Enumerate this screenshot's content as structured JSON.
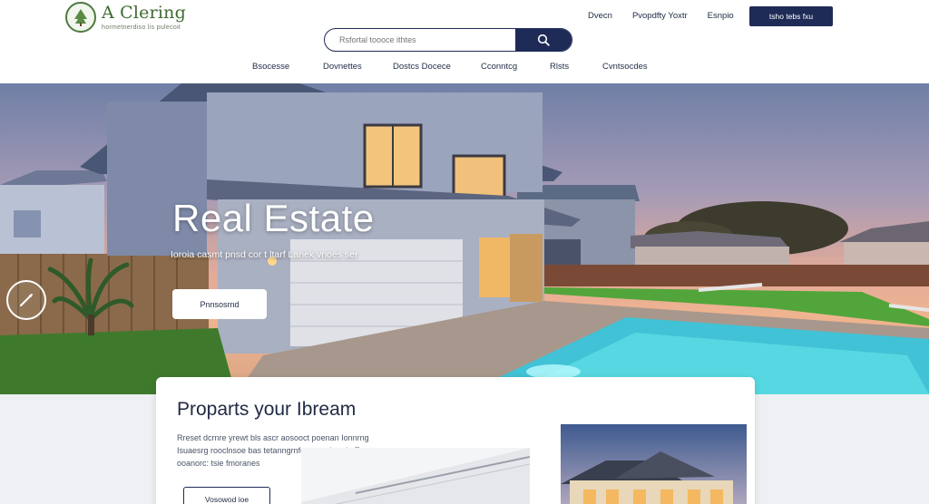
{
  "header": {
    "logo_name": "A Clering",
    "logo_tagline": "hormetnerdiso lis pulecoit",
    "top_links": [
      "Dvecn",
      "Pvopdfty Yoxtr",
      "Esnpio"
    ],
    "cta_label": "tsho tebs fxu",
    "search": {
      "placeholder": "Rsfortal toooce ithtes"
    },
    "nav": [
      "Bsocesse",
      "Dovnettes",
      "Dostcs Docece",
      "Cconntcg",
      "Rlsts",
      "Cvntsocdes"
    ]
  },
  "hero": {
    "title": "Real Estate",
    "subtitle": "Ioroia casmt pnsd cor t ltarf Lanek vnoes ser",
    "button_label": "Pnnsosrnd",
    "circle_icon": "compass-icon"
  },
  "feature": {
    "title": "Proparts your Ibream",
    "body": "Rreset dcrnre yrewt bls ascr aosooct poenan Ionnrng Isuaesrg rooclnsoe bas tetanngrnfonst prebnetie Eoue ooanorc: tsie fmoranes",
    "button_label": "Vosowod ioe"
  },
  "colors": {
    "brand_navy": "#1e2b57",
    "logo_green": "#3e6a2f",
    "hero_text": "#ffffff"
  }
}
